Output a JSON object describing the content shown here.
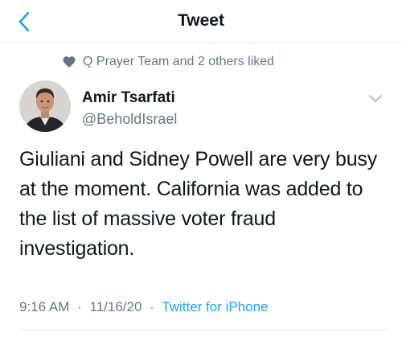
{
  "header": {
    "title": "Tweet",
    "back_icon": "chevron-left-icon"
  },
  "social_context": {
    "icon": "heart-icon",
    "text": "Q Prayer Team and 2 others liked"
  },
  "author": {
    "display_name": "Amir Tsarfati",
    "handle": "@BeholdIsrael"
  },
  "tweet": {
    "text": "Giuliani and Sidney Powell are very busy at the moment. California was added to the list of massive voter fraud investigation."
  },
  "meta": {
    "time": "9:16 AM",
    "separator_1": "·",
    "date": "11/16/20",
    "separator_2": "·",
    "source": "Twitter for iPhone"
  },
  "colors": {
    "accent": "#1da1f2",
    "secondary_text": "#657786",
    "primary_text": "#14171a"
  }
}
